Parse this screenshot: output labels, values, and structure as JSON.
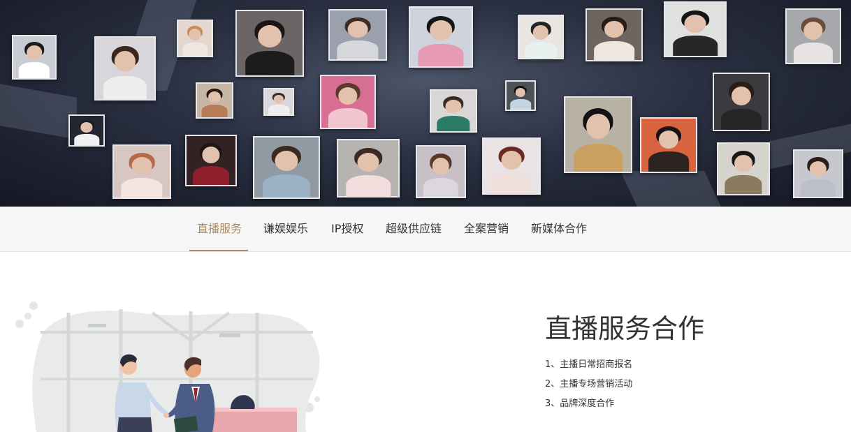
{
  "banner": {
    "portraits": [
      {
        "label": "Man in white shirt",
        "bg": "#c9ccd2",
        "top": "#ffffff",
        "hair": "#1c1c1c"
      },
      {
        "label": "Woman in white top",
        "bg": "#d8d6da",
        "top": "#eeeeee",
        "hair": "#3a2820"
      },
      {
        "label": "Short-haired woman",
        "bg": "#e4d7cf",
        "top": "#f1e6df",
        "hair": "#c98c5a"
      },
      {
        "label": "Woman in black outfit",
        "bg": "#6c6566",
        "top": "#1d1b1c",
        "hair": "#1a1414"
      },
      {
        "label": "Woman with long hair",
        "bg": "#9aa0ac",
        "top": "#d5d7db",
        "hair": "#3b2b26"
      },
      {
        "label": "Woman in pink suit",
        "bg": "#cfd3dd",
        "top": "#e79ab4",
        "hair": "#161616"
      },
      {
        "label": "Man in white shirt 2",
        "bg": "#e9e6e2",
        "top": "#e8f0f0",
        "hair": "#242424"
      },
      {
        "label": "Woman on bike",
        "bg": "#6e6561",
        "top": "#efe7df",
        "hair": "#2a1c17"
      },
      {
        "label": "Man in vest",
        "bg": "#dfe0e0",
        "top": "#272727",
        "hair": "#151515"
      },
      {
        "label": "Woman in blazer",
        "bg": "#a6a8ac",
        "top": "#e6e3e2",
        "hair": "#6b4c3b"
      },
      {
        "label": "Woman with backpack",
        "bg": "#3a3235",
        "top": "#b1a095",
        "hair": "#2b1b15"
      },
      {
        "label": "Woman posing",
        "bg": "#cfc9cf",
        "top": "#f0eaea",
        "hair": "#3a2a24"
      },
      {
        "label": "Girl with bow",
        "bg": "#d76e93",
        "top": "#f2c6d0",
        "hair": "#5b3a2b"
      },
      {
        "label": "Man smiling",
        "bg": "#b8b2a4",
        "top": "#c9a060",
        "hair": "#121212"
      },
      {
        "label": "Woman with bun",
        "bg": "#dad7db",
        "top": "#eeeeee",
        "hair": "#3b2a24"
      },
      {
        "label": "Woman close-up",
        "bg": "#3a3a3f",
        "top": "#262626",
        "hair": "#2a1d18"
      },
      {
        "label": "Small standing woman",
        "bg": "#242633",
        "top": "#f0f0f0",
        "hair": "#1c1c1c"
      },
      {
        "label": "Man in denim jacket",
        "bg": "#4c5258",
        "top": "#c5d4e2",
        "hair": "#111111"
      },
      {
        "label": "Woman on orange",
        "bg": "#d8643f",
        "top": "#2b2222",
        "hair": "#1a1313"
      },
      {
        "label": "Twin sisters",
        "bg": "#d8c6c2",
        "top": "#f3e6e1",
        "hair": "#b66a4a"
      },
      {
        "label": "Woman in red",
        "bg": "#342124",
        "top": "#8e1f2b",
        "hair": "#201515"
      },
      {
        "label": "Woman in blue dress",
        "bg": "#8f9aa2",
        "top": "#9ab1c6",
        "hair": "#3a2a20"
      },
      {
        "label": "Woman with straw hat",
        "bg": "#b7b3b1",
        "top": "#f3dede",
        "hair": "#3a2a23"
      },
      {
        "label": "Woman with hair clip",
        "bg": "#c7c1c7",
        "top": "#dcd7df",
        "hair": "#5a3628"
      },
      {
        "label": "Woman with curly hair",
        "bg": "#e9e3e5",
        "top": "#f0e0dd",
        "hair": "#6a2a22"
      },
      {
        "label": "Man in camo",
        "bg": "#d6d2cc",
        "top": "#8a7a5e",
        "hair": "#171717"
      },
      {
        "label": "Woman in grey",
        "bg": "#c7c8cf",
        "top": "#bcbfc9",
        "hair": "#2a1d18"
      },
      {
        "label": "Woman in green",
        "bg": "#d9d7d6",
        "top": "#2a7c66",
        "hair": "#3a2a22"
      },
      {
        "label": "Small portrait",
        "bg": "#c6b7a7",
        "top": "#b77c55",
        "hair": "#24160f"
      }
    ]
  },
  "tabs": [
    "直播服务",
    "谦娱娱乐",
    "IP授权",
    "超级供应链",
    "全案营销",
    "新媒体合作"
  ],
  "active_tab": "直播服务",
  "section": {
    "title": "直播服务合作",
    "items": [
      "1、主播日常招商报名",
      "2、主播专场营销活动",
      "3、品牌深度合作"
    ]
  },
  "colors": {
    "accent": "#a88c67",
    "text": "#333333",
    "tab_bar_bg": "#f6f6f6"
  }
}
